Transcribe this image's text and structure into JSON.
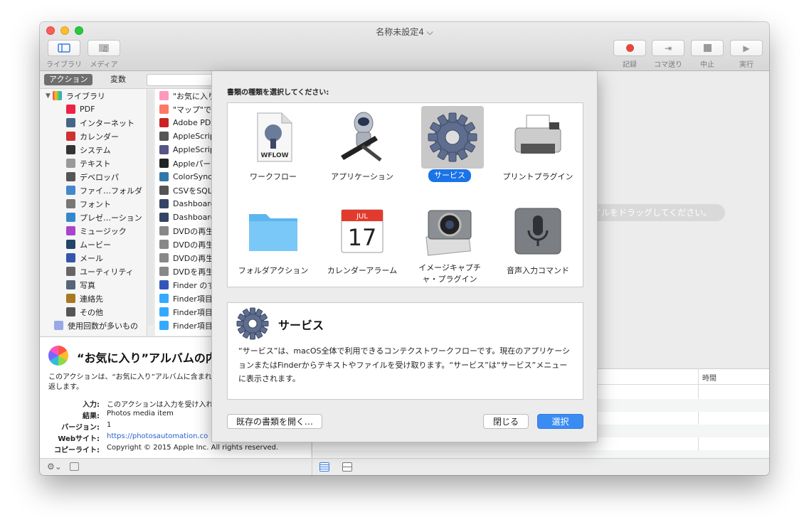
{
  "window": {
    "title": "名称未設定4 ⌵"
  },
  "toolbar": {
    "library": "ライブラリ",
    "media": "メディア",
    "record": "記録",
    "step": "コマ送り",
    "stop": "中止",
    "run": "実行"
  },
  "library_tabs": {
    "actions": "アクション",
    "variables": "変数"
  },
  "library": {
    "root": "ライブラリ",
    "items": [
      "PDF",
      "インターネット",
      "カレンダー",
      "システム",
      "テキスト",
      "デベロッパ",
      "ファイ…フォルダ",
      "フォント",
      "プレゼ…ーション",
      "ミュージック",
      "ムービー",
      "メール",
      "ユーティリティ",
      "写真",
      "連絡先",
      "その他"
    ],
    "frequent": "使用回数が多いもの"
  },
  "actions_list": [
    "\"お気に入り",
    "\"マップ\"で使",
    "Adobe PDF",
    "AppleScript",
    "AppleScrip",
    "Appleパー",
    "ColorSync",
    "CSVをSQL",
    "Dashboard",
    "Dashboard",
    "DVDの再生",
    "DVDの再生",
    "DVDの再生",
    "DVDを再生",
    "Finder のす",
    "Finder項目",
    "Finder項目",
    "Finder項目"
  ],
  "description": {
    "title": "“お気に入り”アルバムの内",
    "text": "このアクションは、“お気に入り”アルバムに含まれ返します。",
    "rows": [
      {
        "k": "入力:",
        "v": "このアクションは入力を受け入れ"
      },
      {
        "k": "結果:",
        "v": "Photos media item"
      },
      {
        "k": "バージョン:",
        "v": "1"
      },
      {
        "k": "Webサイト:",
        "v": "https://photosautomation.co"
      },
      {
        "k": "コピーライト:",
        "v": "Copyright © 2015 Apple Inc. All rights reserved."
      }
    ]
  },
  "workflow": {
    "drag_hint": "イルをドラッグしてください。",
    "log_col": "時間"
  },
  "sheet": {
    "prompt": "書類の種類を選択してください:",
    "types": [
      {
        "label": "ワークフロー",
        "icon": "workflow-icon"
      },
      {
        "label": "アプリケーション",
        "icon": "application-icon"
      },
      {
        "label": "サービス",
        "icon": "service-gear-icon"
      },
      {
        "label": "プリントプラグイン",
        "icon": "printer-icon"
      },
      {
        "label": "フォルダアクション",
        "icon": "folder-icon"
      },
      {
        "label": "カレンダーアラーム",
        "icon": "calendar-icon"
      },
      {
        "label": "イメージキャプチャ・プラグイン",
        "icon": "camera-icon"
      },
      {
        "label": "音声入力コマンド",
        "icon": "microphone-icon"
      }
    ],
    "wflow_text": "WFLOW",
    "cal_month": "JUL",
    "cal_day": "17",
    "selected_title": "サービス",
    "selected_desc": "“サービス”は、macOS全体で利用できるコンテクストワークフローです。現在のアプリケーションまたはFinderからテキストやファイルを受け取ります。“サービス”は“サービス”メニューに表示されます。",
    "open_existing": "既存の書類を開く…",
    "close": "閉じる",
    "choose": "選択"
  },
  "colors": {
    "accent": "#1a73e8",
    "selected_tile": "#c8c8c8"
  }
}
